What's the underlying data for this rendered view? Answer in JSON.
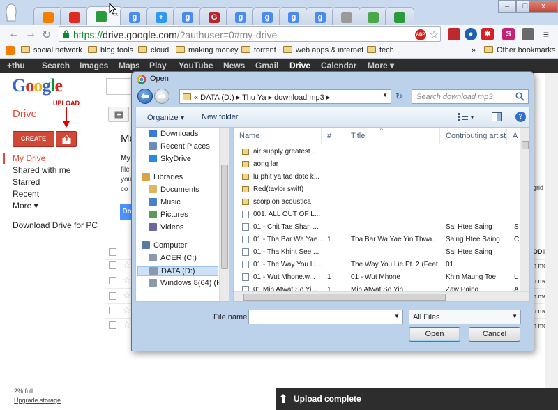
{
  "browser": {
    "tabs": [
      {
        "icon": "ghost-profile-icon",
        "color": "#ffffff"
      },
      {
        "icon": "blogger-icon",
        "letter": "",
        "color": "#f57d00"
      },
      {
        "icon": "youtube-icon",
        "letter": "",
        "color": "#e02a20"
      },
      {
        "icon": "google-drive-icon",
        "letter": "",
        "color": "#2a9a3a",
        "active": true
      },
      {
        "icon": "google-icon",
        "letter": "g",
        "color": "#4a8af4"
      },
      {
        "icon": "google-plus-icon",
        "letter": "+",
        "color": "#2a9af4"
      },
      {
        "icon": "google-icon",
        "letter": "g",
        "color": "#4a8af4"
      },
      {
        "icon": "red-circle-icon",
        "letter": "G",
        "color": "#b8262b"
      },
      {
        "icon": "google-icon",
        "letter": "g",
        "color": "#4a8af4"
      },
      {
        "icon": "google-icon",
        "letter": "g",
        "color": "#4a8af4"
      },
      {
        "icon": "google-icon",
        "letter": "g",
        "color": "#4a8af4"
      },
      {
        "icon": "google-icon",
        "letter": "g",
        "color": "#4a8af4"
      },
      {
        "icon": "apple-icon",
        "letter": "",
        "color": "#9a9a9a"
      },
      {
        "icon": "play-store-icon",
        "letter": "",
        "color": "#4aa84a"
      },
      {
        "icon": "google-drive-icon",
        "letter": "",
        "color": "#2a9a3a"
      }
    ],
    "tab_close": "×",
    "window_controls": {
      "minimize": "–",
      "maximize": "□",
      "close": "x"
    },
    "url_scheme": "https://",
    "url_host": "drive.google.com",
    "url_rest": "/?authuser=0#my-drive",
    "bookmarks": [
      "social network",
      "blog tools",
      "cloud",
      "making money",
      "torrent",
      "web apps & internet",
      "tech"
    ],
    "bookmarks_more": "»",
    "other_bookmarks": "Other bookmarks"
  },
  "google_bar": [
    {
      "label": "+thu",
      "selected": false
    },
    {
      "label": "Search",
      "selected": false
    },
    {
      "label": "Images",
      "selected": false
    },
    {
      "label": "Maps",
      "selected": false
    },
    {
      "label": "Play",
      "selected": false
    },
    {
      "label": "YouTube",
      "selected": false
    },
    {
      "label": "News",
      "selected": false
    },
    {
      "label": "Gmail",
      "selected": false
    },
    {
      "label": "Drive",
      "selected": true
    },
    {
      "label": "Calendar",
      "selected": false
    },
    {
      "label": "More ▾",
      "selected": false
    }
  ],
  "drive": {
    "logo": [
      "G",
      "o",
      "o",
      "g",
      "l",
      "e"
    ],
    "title": "Drive",
    "upload_annotation": "UPLOAD",
    "create_label": "CREATE",
    "nav": [
      {
        "label": "My Drive",
        "selected": true
      },
      {
        "label": "Shared with me",
        "selected": false
      },
      {
        "label": "Starred",
        "selected": false
      },
      {
        "label": "Recent",
        "selected": false
      },
      {
        "label": "More ▾",
        "selected": false
      }
    ],
    "download_link": "Download Drive for PC",
    "storage_used": "2% full",
    "upgrade_link": "Upgrade storage",
    "welcome_title": "Mc",
    "welcome_lines": [
      "My",
      "file",
      "you",
      "co"
    ],
    "welcome_button": "Do",
    "grid_view_text": "grid vie",
    "modified_header": "ODIFIE",
    "row_meta": [
      "n me",
      "n me",
      "n me",
      "n me",
      "n me"
    ],
    "toast": "Upload complete"
  },
  "dialog": {
    "title": "Open",
    "breadcrumb": "«  DATA (D:)  ▸  Thu Ya  ▸  download mp3  ▸",
    "search_placeholder": "Search download mp3",
    "organize": "Organize ▾",
    "new_folder": "New folder",
    "view_menu": "▾",
    "help": "?",
    "nav_tree": [
      {
        "label": "Downloads",
        "icon": "downloads-folder-icon",
        "color": "#3a7bd5",
        "indent": 0
      },
      {
        "label": "Recent Places",
        "icon": "recent-places-icon",
        "color": "#6c8cb8",
        "indent": 0
      },
      {
        "label": "SkyDrive",
        "icon": "skydrive-icon",
        "color": "#2a8ae0",
        "indent": 0
      },
      {
        "label": "Libraries",
        "icon": "libraries-icon",
        "color": "#d8a640",
        "indent": -1,
        "gap": true
      },
      {
        "label": "Documents",
        "icon": "documents-icon",
        "color": "#d8b860",
        "indent": 0
      },
      {
        "label": "Music",
        "icon": "music-icon",
        "color": "#4a80c8",
        "indent": 0
      },
      {
        "label": "Pictures",
        "icon": "pictures-icon",
        "color": "#5a9a5a",
        "indent": 0
      },
      {
        "label": "Videos",
        "icon": "videos-icon",
        "color": "#6a6a9a",
        "indent": 0
      },
      {
        "label": "Computer",
        "icon": "computer-icon",
        "color": "#5a7aa0",
        "indent": -1,
        "gap": true
      },
      {
        "label": "ACER (C:)",
        "icon": "drive-icon",
        "color": "#8a9aaa",
        "indent": 0
      },
      {
        "label": "DATA (D:)",
        "icon": "drive-icon",
        "color": "#8a9aaa",
        "indent": 0,
        "selected": true
      },
      {
        "label": "Windows 8(64) (H",
        "icon": "drive-icon",
        "color": "#8a9aaa",
        "indent": 0
      }
    ],
    "columns": [
      {
        "label": "Name",
        "sorted": true
      },
      {
        "label": "#"
      },
      {
        "label": "Title"
      },
      {
        "label": "Contributing artists"
      },
      {
        "label": "A"
      }
    ],
    "files": [
      {
        "name": "air supply greatest ...",
        "num": "",
        "title": "",
        "artist": "",
        "extra": "",
        "folder": true
      },
      {
        "name": "aong lar",
        "num": "",
        "title": "",
        "artist": "",
        "extra": "",
        "folder": true
      },
      {
        "name": "lu phit ya tae dote k...",
        "num": "",
        "title": "",
        "artist": "",
        "extra": "",
        "folder": true
      },
      {
        "name": "Red(taylor swift)",
        "num": "",
        "title": "",
        "artist": "",
        "extra": "",
        "folder": true
      },
      {
        "name": "scorpion acoustica",
        "num": "",
        "title": "",
        "artist": "",
        "extra": "",
        "folder": true
      },
      {
        "name": "001. ALL OUT OF L...",
        "num": "",
        "title": "",
        "artist": "",
        "extra": "",
        "folder": false
      },
      {
        "name": "01 - Chit Tae Shan ...",
        "num": "",
        "title": "",
        "artist": "Sai Htee Saing",
        "extra": "S",
        "folder": false
      },
      {
        "name": "01 - Tha Bar Wa Yae...",
        "num": "1",
        "title": "Tha Bar Wa Yae Yin Thwa...",
        "artist": "Saing Htee Saing",
        "extra": "C",
        "folder": false
      },
      {
        "name": "01 - Tha Khint See ...",
        "num": "",
        "title": "",
        "artist": "Sai Htee Saing",
        "extra": "",
        "folder": false
      },
      {
        "name": "01 - The Way You Li...",
        "num": "",
        "title": "The Way You Lie Pt. 2 (Feat.",
        "artist": "01",
        "extra": "",
        "folder": false
      },
      {
        "name": "01 - Wut Mhone.w...",
        "num": "1",
        "title": "01 - Wut Mhone",
        "artist": "Khin Maung Toe",
        "extra": "L",
        "folder": false
      },
      {
        "name": "01 Min Atwat So Yi...",
        "num": "1",
        "title": "Min Atwat So Yin",
        "artist": "Zaw Paing",
        "extra": "A",
        "folder": false
      }
    ],
    "filename_label": "File name:",
    "filename_value": "",
    "filter": "All Files",
    "open_button": "Open",
    "cancel_button": "Cancel"
  }
}
